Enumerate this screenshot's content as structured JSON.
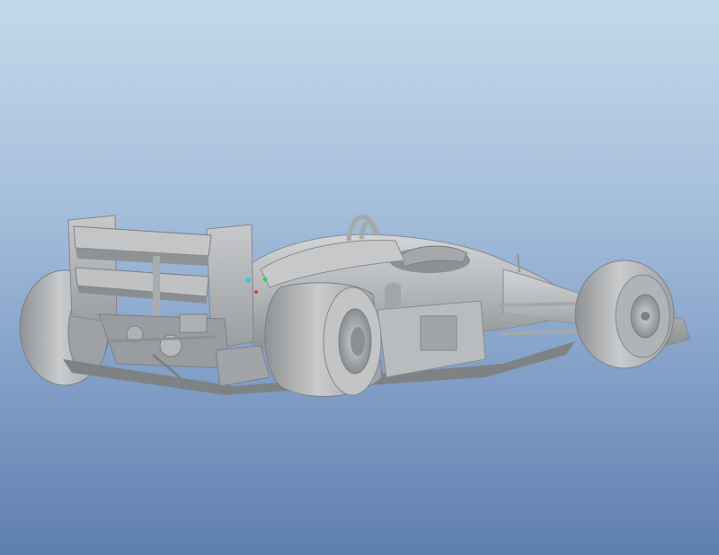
{
  "viewport": {
    "background_top": "#c3d8ea",
    "background_bottom": "#5e7eaf"
  },
  "model": {
    "icon": "f1-car-model",
    "shade_color": "#b4b7b9"
  },
  "datum_markers": [
    {
      "name": "datum-point-x",
      "color": "#ff3030"
    },
    {
      "name": "datum-point-y",
      "color": "#30d050"
    },
    {
      "name": "datum-point-z",
      "color": "#30c8e0"
    }
  ]
}
